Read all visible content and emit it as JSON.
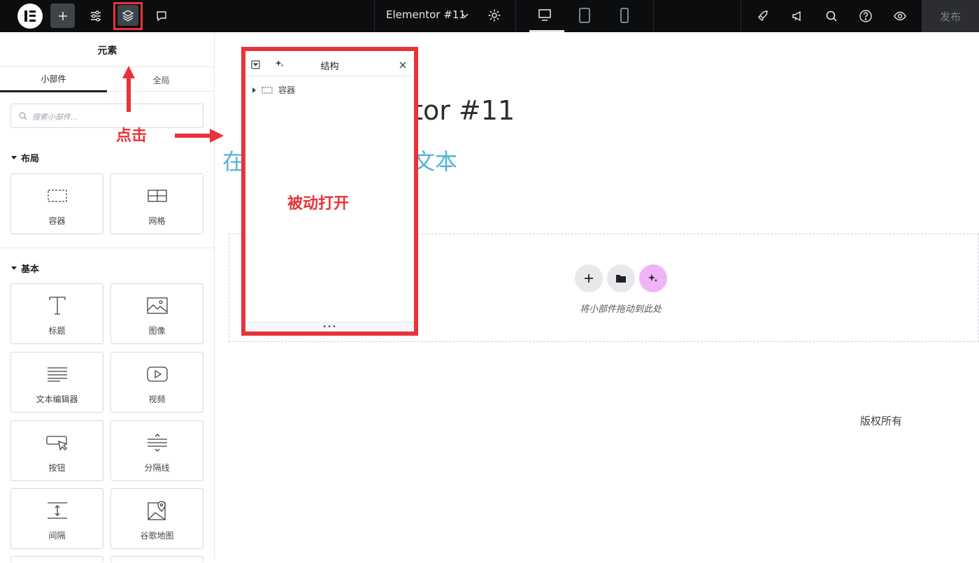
{
  "topbar": {
    "logo": "elementor-logo",
    "icons": [
      "plus-icon",
      "sliders-icon",
      "layers-icon",
      "chat-icon"
    ],
    "document_title": "Elementor #11",
    "devices": [
      "desktop-icon",
      "tablet-icon",
      "mobile-icon"
    ],
    "right_icons": [
      "rocket-icon",
      "megaphone-icon",
      "search-icon",
      "help-icon",
      "eye-icon"
    ],
    "publish_label": "发布"
  },
  "panel": {
    "title": "元素",
    "tabs": [
      "小部件",
      "全局"
    ],
    "search_placeholder": "搜索小部件...",
    "sections": [
      {
        "title": "布局",
        "widgets": [
          {
            "label": "容器",
            "icon": "container-icon"
          },
          {
            "label": "网格",
            "icon": "grid-icon"
          }
        ]
      },
      {
        "title": "基本",
        "widgets": [
          {
            "label": "标题",
            "icon": "heading-icon"
          },
          {
            "label": "图像",
            "icon": "image-icon"
          },
          {
            "label": "文本编辑器",
            "icon": "text-editor-icon"
          },
          {
            "label": "视频",
            "icon": "video-icon"
          },
          {
            "label": "按钮",
            "icon": "button-icon"
          },
          {
            "label": "分隔线",
            "icon": "divider-icon"
          },
          {
            "label": "间隔",
            "icon": "spacer-icon"
          },
          {
            "label": "谷歌地图",
            "icon": "google-maps-icon"
          }
        ]
      }
    ]
  },
  "canvas": {
    "heading_visible": "ntor #11",
    "subtext_left": "在",
    "subtext_right": "文本",
    "dropzone_hint": "将小部件拖动到此处",
    "copyright": "版权所有"
  },
  "structure_panel": {
    "title": "结构",
    "items": [
      {
        "label": "容器"
      }
    ]
  },
  "annotations": {
    "click": "点击",
    "opened": "被动打开"
  },
  "colors": {
    "topbar_bg": "#0c0d0e",
    "annotation_red": "#e8333a",
    "accent_blue": "#56b4d6",
    "ai_pink": "#f0b4f5"
  }
}
